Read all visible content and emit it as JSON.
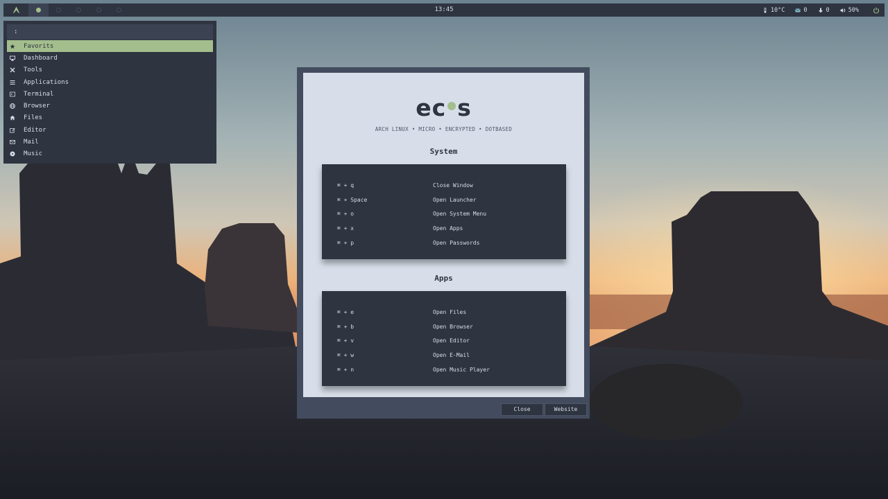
{
  "colors": {
    "accent": "#a3be8c",
    "bar_bg": "#2e3440",
    "panel_bg": "#3b4252",
    "dialog_frame": "#434c5e",
    "dialog_content": "#d8dee9",
    "text_light": "#d8dee9",
    "text_dark": "#2e3440"
  },
  "topbar": {
    "logo_icon": "arch-logo-icon",
    "workspaces": [
      {
        "icon": "dot-icon",
        "active": true
      },
      {
        "icon": "dot-icon",
        "active": false
      },
      {
        "icon": "dot-icon",
        "active": false
      },
      {
        "icon": "dot-icon",
        "active": false
      },
      {
        "icon": "dot-icon",
        "active": false
      }
    ],
    "clock": "13:45",
    "status": {
      "temperature": "10°C",
      "mail": "0",
      "updates": "0",
      "volume": "50%"
    },
    "power_icon": "power-icon"
  },
  "launcher": {
    "input_value": ":",
    "items": [
      {
        "label": "Favorits",
        "icon": "star-icon",
        "selected": true
      },
      {
        "label": "Dashboard",
        "icon": "monitor-icon",
        "selected": false
      },
      {
        "label": "Tools",
        "icon": "tools-icon",
        "selected": false
      },
      {
        "label": "Applications",
        "icon": "list-icon",
        "selected": false
      },
      {
        "label": "Terminal",
        "icon": "terminal-icon",
        "selected": false
      },
      {
        "label": "Browser",
        "icon": "globe-icon",
        "selected": false
      },
      {
        "label": "Files",
        "icon": "home-icon",
        "selected": false
      },
      {
        "label": "Editor",
        "icon": "edit-icon",
        "selected": false
      },
      {
        "label": "Mail",
        "icon": "mail-icon",
        "selected": false
      },
      {
        "label": "Music",
        "icon": "music-icon",
        "selected": false
      }
    ]
  },
  "dialog": {
    "logo_left": "ec",
    "logo_right": "s",
    "tagline": "ARCH LINUX • MICRO • ENCRYPTED • DOTBASED",
    "system_title": "System",
    "system_keys": [
      {
        "combo": "⌘ + q",
        "action": "Close Window"
      },
      {
        "combo": "⌘ + Space",
        "action": "Open Launcher"
      },
      {
        "combo": "⌘ + o",
        "action": "Open System Menu"
      },
      {
        "combo": "⌘ + x",
        "action": "Open Apps"
      },
      {
        "combo": "⌘ + p",
        "action": "Open Passwords"
      }
    ],
    "apps_title": "Apps",
    "apps_keys": [
      {
        "combo": "⌘ + e",
        "action": "Open Files"
      },
      {
        "combo": "⌘ + b",
        "action": "Open Browser"
      },
      {
        "combo": "⌘ + v",
        "action": "Open Editor"
      },
      {
        "combo": "⌘ + w",
        "action": "Open E-Mail"
      },
      {
        "combo": "⌘ + n",
        "action": "Open Music Player"
      }
    ],
    "close_label": "Close",
    "website_label": "Website"
  }
}
